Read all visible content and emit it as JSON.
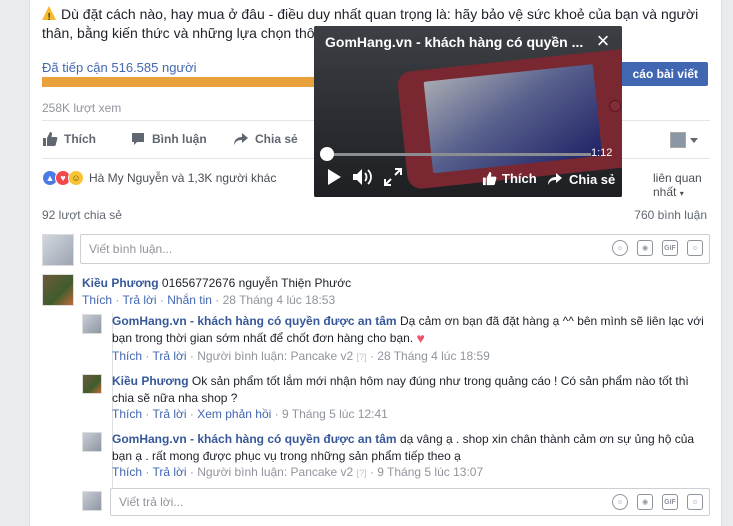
{
  "post": {
    "text": "Dù đặt cách nào, hay mua ở đâu - điều duy nhất quan trọng là: hãy bảo vệ sức khoẻ của bạn và người thân, bằng kiến thức và những lựa chọn thô",
    "reach_label": "Đã tiếp cận 516.585 người",
    "reach_progress": 0.41,
    "boost_button": "cáo bài viết",
    "views": "258K lượt xem"
  },
  "actions": {
    "like": "Thích",
    "comment": "Bình luận",
    "share": "Chia sẻ"
  },
  "reactions": {
    "text": "Hà My Nguyễn và 1,3K người khác",
    "sort": "liên quan nhất"
  },
  "stats": {
    "shares": "92 lượt chia sẻ",
    "comments": "760 bình luận"
  },
  "composer": {
    "placeholder": "Viết bình luận..."
  },
  "comments": [
    {
      "author": "Kiều Phương",
      "text": "01656772676 nguyễn Thiện Phước",
      "like": "Thích",
      "reply": "Trả lời",
      "message": "Nhắn tin",
      "time": "28 Tháng 4 lúc 18:53"
    }
  ],
  "replies": [
    {
      "author": "GomHang.vn - khách hàng có quyền được an tâm",
      "text": "Dạ cảm ơn bạn đã đặt hàng ạ ^^ bên mình sẽ liên lạc với bạn trong thời gian sớm nhất để chốt đơn hàng cho bạn.",
      "like": "Thích",
      "reply": "Trả lời",
      "responder": "Người bình luận: Pancake v2",
      "qmark": "[?]",
      "time": "28 Tháng 4 lúc 18:59"
    },
    {
      "author": "Kiều Phương",
      "text": "Ok sản phẩm tốt lắm mới nhận hôm nay đúng như trong quảng cáo ! Có sản phẩm nào tốt thì chia sẽ nữa nha shop ?",
      "like": "Thích",
      "reply": "Trả lời",
      "see_reply": "Xem phản hồi",
      "time": "9 Tháng 5 lúc 12:41"
    },
    {
      "author": "GomHang.vn - khách hàng có quyền được an tâm",
      "text": "dạ vâng ạ . shop xin chân thành cảm ơn sự ủng hộ của bạn ạ . rất mong được phục vụ trong những sản phẩm tiếp theo ạ",
      "like": "Thích",
      "reply": "Trả lời",
      "responder": "Người bình luận: Pancake v2",
      "qmark": "[?]",
      "time": "9 Tháng 5 lúc 13:07"
    }
  ],
  "reply_composer": {
    "placeholder": "Viết trả lời..."
  },
  "composer_icons": [
    "emoji-icon",
    "camera-icon",
    "gif-icon",
    "sticker-icon"
  ],
  "gif_label": "GIF",
  "video": {
    "title": "GomHang.vn - khách hàng có quyền ...",
    "time": "1:12",
    "progress": 0.02,
    "like": "Thích",
    "share": "Chia sẻ"
  },
  "colors": {
    "link": "#365899",
    "brand_blue": "#4267b2",
    "reach_bar": "#e9a23b"
  }
}
